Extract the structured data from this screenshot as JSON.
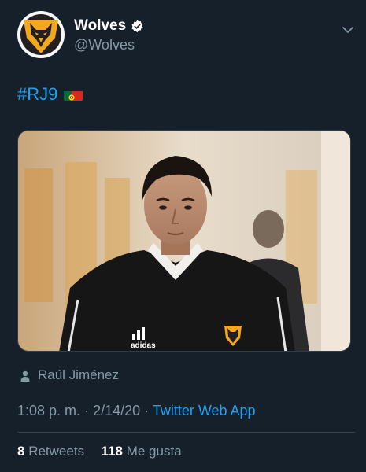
{
  "user": {
    "display_name": "Wolves",
    "handle": "@Wolves",
    "verified_icon": "verified-badge-icon",
    "avatar": "wolves-crest-logo"
  },
  "tweet": {
    "hashtag": "#RJ9",
    "flag_icon": "portugal-flag-icon"
  },
  "media": {
    "kit_brand": "adidas"
  },
  "tag": {
    "name": "Raúl Jiménez"
  },
  "meta": {
    "time": "1:08 p. m.",
    "separator": "·",
    "date": "2/14/20",
    "source": "Twitter Web App"
  },
  "stats": {
    "retweets_count": "8",
    "retweets_label": "Retweets",
    "likes_count": "118",
    "likes_label": "Me gusta"
  },
  "colors": {
    "background": "#15202b",
    "link": "#1da1f2",
    "muted": "#8899a6",
    "gold": "#f4a81d"
  }
}
